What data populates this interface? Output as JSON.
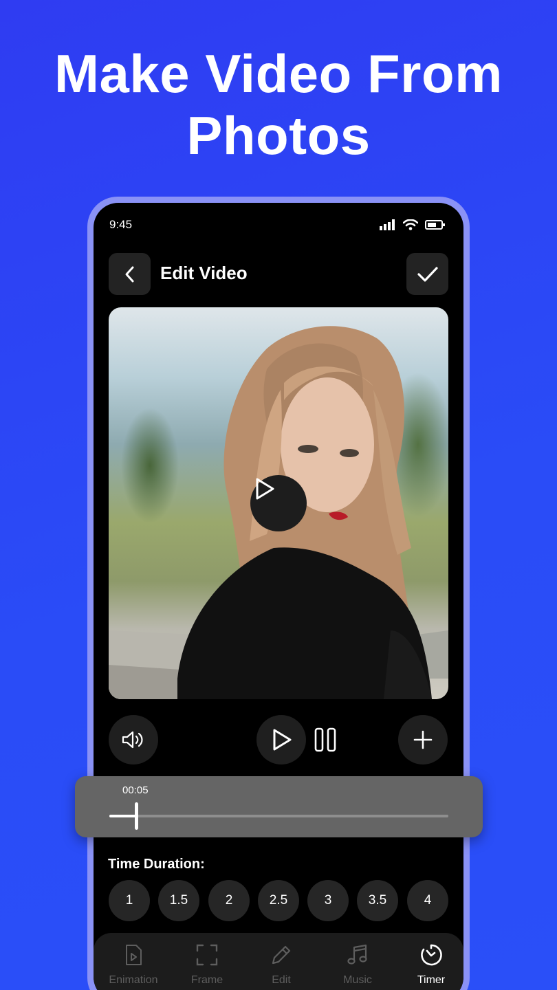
{
  "headline": {
    "line1": "Make Video From",
    "line2": "Photos"
  },
  "status_bar": {
    "time": "9:45"
  },
  "topbar": {
    "title": "Edit Video"
  },
  "timeline": {
    "current_time": "00:05",
    "progress": 0.08
  },
  "duration": {
    "label": "Time Duration:",
    "options": [
      "1",
      "1.5",
      "2",
      "2.5",
      "3",
      "3.5",
      "4"
    ]
  },
  "bottom_nav": {
    "items": [
      {
        "label": "Enimation",
        "icon": "animation-file-icon"
      },
      {
        "label": "Frame",
        "icon": "frame-icon"
      },
      {
        "label": "Edit",
        "icon": "pencil-icon"
      },
      {
        "label": "Music",
        "icon": "music-note-icon"
      },
      {
        "label": "Timer",
        "icon": "timer-icon"
      }
    ],
    "active": "Timer"
  },
  "colors": {
    "background": "#2a4cf7",
    "phone_frame": "#8a92f6",
    "screen": "#000000",
    "timeline_panel": "#656565"
  }
}
